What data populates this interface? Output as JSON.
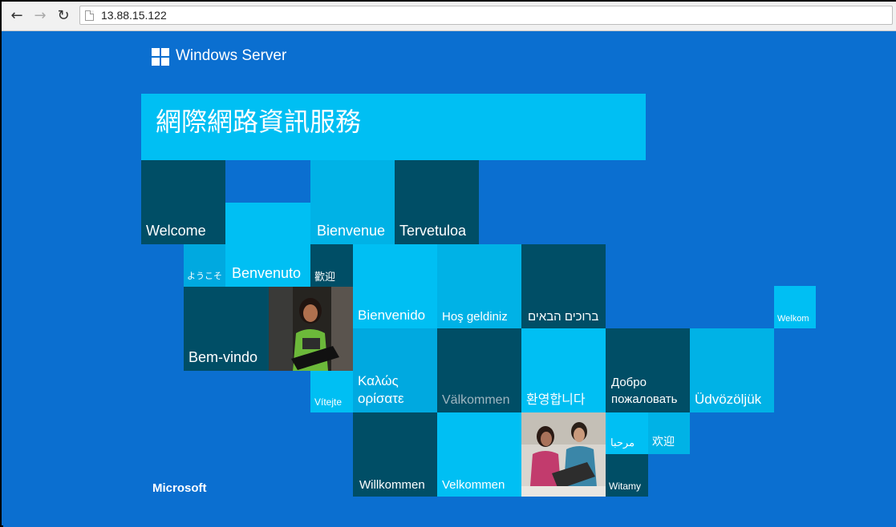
{
  "browser": {
    "back_icon": "arrow-left-icon",
    "forward_icon": "arrow-right-icon",
    "reload_icon": "reload-icon",
    "url": "13.88.15.122"
  },
  "page": {
    "logo_text": "Windows Server",
    "title": "網際網路資訊服務",
    "footer_brand": "Microsoft",
    "colors": {
      "background": "#0b6fd0",
      "dark_tile": "#004e66",
      "light_tile": "#00bff3",
      "mid_tile": "#00b2e6"
    },
    "tiles": {
      "welcome": "Welcome",
      "bienvenue": "Bienvenue",
      "tervetuloa": "Tervetuloa",
      "youkoso": "ようこそ",
      "benvenuto": "Benvenuto",
      "huanying_trad": "歡迎",
      "bienvenido": "Bienvenido",
      "hos_geldiniz": "Hoş geldiniz",
      "hebrew": "ברוכים הבאים",
      "welkom": "Welkom",
      "bem_vindo": "Bem-vindo",
      "greek": "Καλώς ορίσατε",
      "vitejte": "Vítejte",
      "valkommen": "Välkommen",
      "korean": "환영합니다",
      "russian": "Добро пожаловать",
      "udvozoljuk": "Üdvözöljük",
      "arabic": "مرحبا",
      "huanying_simp": "欢迎",
      "willkommen": "Willkommen",
      "velkommen": "Velkommen",
      "witamy": "Witamy"
    }
  }
}
